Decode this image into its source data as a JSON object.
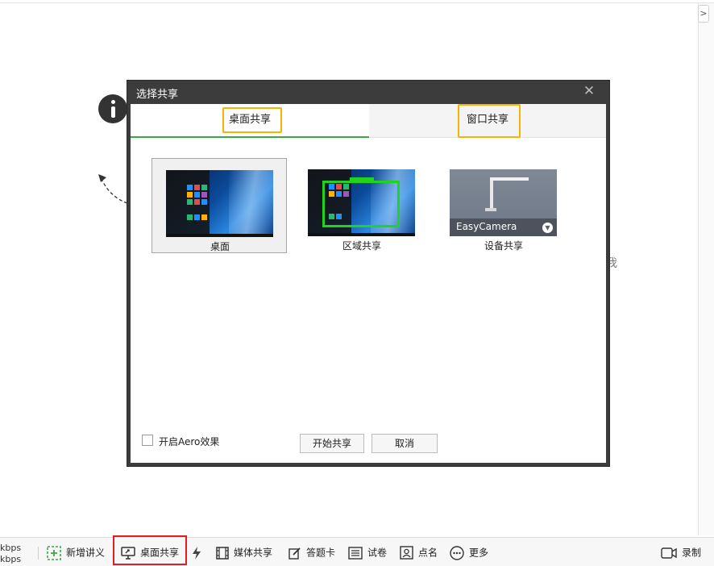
{
  "dialog": {
    "title": "选择共享",
    "close_glyph": "✕",
    "tabs": [
      {
        "label": "桌面共享",
        "active": true
      },
      {
        "label": "窗口共享",
        "active": false
      }
    ],
    "options": [
      {
        "label": "桌面",
        "selected": true,
        "thumb": "windows-desktop"
      },
      {
        "label": "区域共享",
        "selected": false,
        "thumb": "region-select"
      },
      {
        "label": "设备共享",
        "selected": false,
        "thumb": "camera-device",
        "device_name": "EasyCamera"
      }
    ],
    "aero_label": "开启Aero效果",
    "aero_checked": false,
    "start_label": "开始共享",
    "cancel_label": "取消"
  },
  "toolbar": {
    "bitrate_up": "kbps",
    "bitrate_down": "kbps",
    "items": [
      {
        "label": "新增讲义",
        "icon": "add-doc-icon"
      },
      {
        "label": "桌面共享",
        "icon": "monitor-share-icon",
        "highlighted": true
      },
      {
        "label": "",
        "icon": "lightning-icon"
      },
      {
        "label": "媒体共享",
        "icon": "film-icon"
      },
      {
        "label": "答题卡",
        "icon": "edit-icon"
      },
      {
        "label": "试卷",
        "icon": "exam-icon"
      },
      {
        "label": "点名",
        "icon": "rollcall-icon"
      },
      {
        "label": "更多",
        "icon": "more-icon"
      },
      {
        "label": "录制",
        "icon": "video-camera-icon"
      }
    ]
  },
  "background": {
    "side_glyph": "我",
    "collapse_glyph": ">"
  },
  "colors": {
    "tab_active_underline": "#3aa845",
    "annotation_highlight": "#f5b400",
    "toolbar_highlight": "#e02020",
    "add_icon_green": "#3aa845",
    "region_green": "#1fd31f"
  }
}
